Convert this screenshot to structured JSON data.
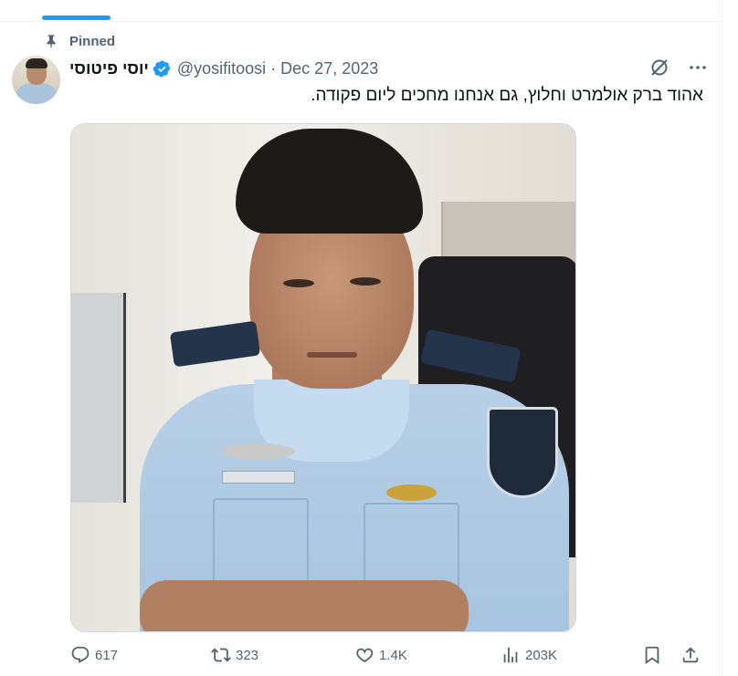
{
  "pinned": {
    "label": "Pinned",
    "icon": "pin-icon"
  },
  "tweet": {
    "author_name": "יוסי פיטוסי",
    "handle": "@yosifitoosi",
    "separator": "·",
    "date": "Dec 27, 2023",
    "verified": true,
    "text": "אהוד ברק אולמרט וחלוץ, גם אנחנו מחכים ליום פקודה."
  },
  "actions": {
    "replies": "617",
    "reposts": "323",
    "likes": "1.4K",
    "views": "203K"
  },
  "colors": {
    "accent": "#1d9bf0",
    "muted_text": "#536471",
    "text": "#0f1419"
  }
}
